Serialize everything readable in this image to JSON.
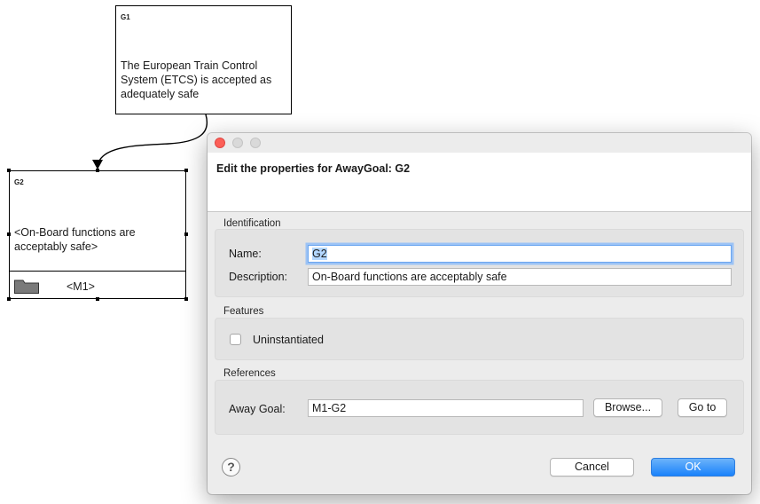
{
  "diagram": {
    "g1": {
      "id": "G1",
      "text": "The European Train Control\nSystem (ETCS) is accepted as\nadequately safe"
    },
    "g2": {
      "id": "G2",
      "text": "<On-Board functions are\nacceptably safe>",
      "module_label": "<M1>"
    }
  },
  "dialog": {
    "header_title": "Edit the properties for AwayGoal: G2",
    "identification": {
      "section_label": "Identification",
      "name_label": "Name:",
      "name_value": "G2",
      "description_label": "Description:",
      "description_value": "On-Board functions are acceptably safe"
    },
    "features": {
      "section_label": "Features",
      "uninstantiated_label": "Uninstantiated",
      "uninstantiated_checked": false
    },
    "references": {
      "section_label": "References",
      "away_goal_label": "Away Goal:",
      "away_goal_value": "M1-G2",
      "browse_label": "Browse...",
      "goto_label": "Go to"
    },
    "footer": {
      "help_glyph": "?",
      "cancel_label": "Cancel",
      "ok_label": "OK"
    }
  },
  "colors": {
    "close_button": "#fc5f57",
    "primary_button": "#1a82fb",
    "focus_ring": "#9cc3f5",
    "selection": "#b3d7ff"
  }
}
